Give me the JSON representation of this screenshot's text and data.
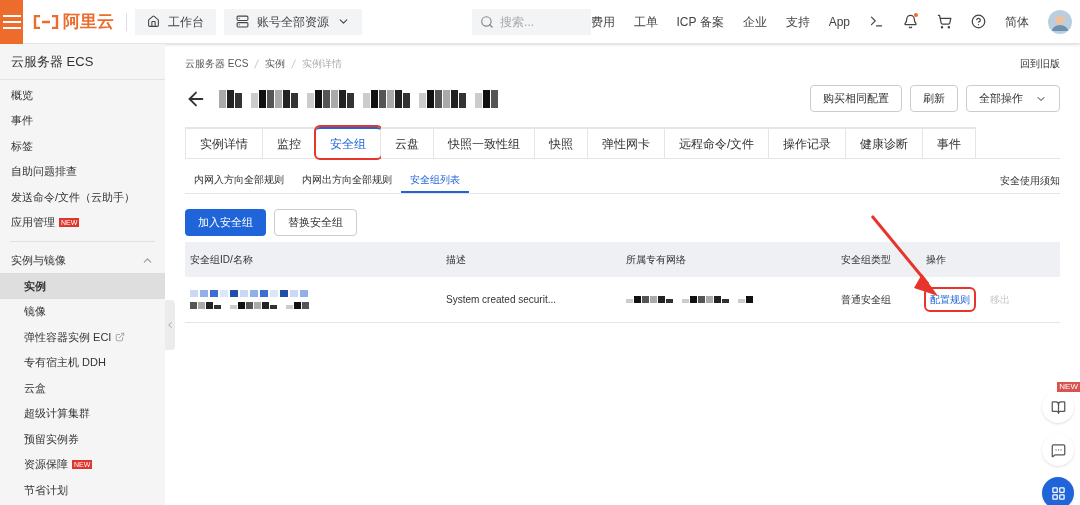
{
  "topbar": {
    "logo_text": "阿里云",
    "workbench": "工作台",
    "resources": "账号全部资源",
    "search_placeholder": "搜索...",
    "links": [
      "费用",
      "工单",
      "ICP 备案",
      "企业",
      "支持",
      "App"
    ],
    "language": "简体"
  },
  "sidebar": {
    "title": "云服务器 ECS",
    "items": [
      {
        "label": "概览",
        "selected": false
      },
      {
        "label": "事件",
        "selected": false
      },
      {
        "label": "标签",
        "selected": false
      },
      {
        "label": "自助问题排查",
        "selected": false
      },
      {
        "label": "发送命令/文件（云助手）",
        "selected": false
      },
      {
        "label": "应用管理",
        "badge": "NEW",
        "selected": false
      }
    ],
    "groups": [
      {
        "label": "实例与镜像",
        "expanded": true,
        "children": [
          {
            "label": "实例",
            "selected": true
          },
          {
            "label": "镜像",
            "selected": false
          },
          {
            "label": "弹性容器实例 ECI",
            "external": true,
            "selected": false
          },
          {
            "label": "专有宿主机 DDH",
            "selected": false
          },
          {
            "label": "云盒",
            "selected": false
          },
          {
            "label": "超级计算集群",
            "selected": false
          },
          {
            "label": "预留实例券",
            "selected": false
          },
          {
            "label": "资源保障",
            "badge": "NEW",
            "selected": false
          },
          {
            "label": "节省计划",
            "selected": false
          }
        ]
      }
    ]
  },
  "breadcrumb": [
    "云服务器 ECS",
    "实例",
    "实例详情"
  ],
  "back_to_old": "回到旧版",
  "header_buttons": [
    {
      "label": "购买相同配置",
      "dropdown": false
    },
    {
      "label": "刷新",
      "dropdown": false
    },
    {
      "label": "全部操作",
      "dropdown": true
    }
  ],
  "tabs": [
    {
      "label": "实例详情",
      "selected": false,
      "highlighted": false
    },
    {
      "label": "监控",
      "selected": false,
      "highlighted": false
    },
    {
      "label": "安全组",
      "selected": true,
      "highlighted": true
    },
    {
      "label": "云盘",
      "selected": false,
      "highlighted": false
    },
    {
      "label": "快照一致性组",
      "selected": false,
      "highlighted": false
    },
    {
      "label": "快照",
      "selected": false,
      "highlighted": false
    },
    {
      "label": "弹性网卡",
      "selected": false,
      "highlighted": false
    },
    {
      "label": "远程命令/文件",
      "selected": false,
      "highlighted": false
    },
    {
      "label": "操作记录",
      "selected": false,
      "highlighted": false
    },
    {
      "label": "健康诊断",
      "selected": false,
      "highlighted": false
    },
    {
      "label": "事件",
      "selected": false,
      "highlighted": false
    }
  ],
  "subtabs": [
    {
      "label": "内网入方向全部规则",
      "selected": false
    },
    {
      "label": "内网出方向全部规则",
      "selected": false
    },
    {
      "label": "安全组列表",
      "selected": true
    }
  ],
  "notice_link": "安全使用须知",
  "actions": [
    {
      "label": "加入安全组",
      "kind": "primary"
    },
    {
      "label": "替换安全组",
      "kind": "default"
    }
  ],
  "table": {
    "columns": [
      "安全组ID/名称",
      "描述",
      "所属专有网络",
      "安全组类型",
      "操作"
    ],
    "rows": [
      {
        "description": "System created securit...",
        "type": "普通安全组",
        "actions": [
          {
            "label": "配置规则",
            "disabled": false,
            "highlighted": true
          },
          {
            "label": "移出",
            "disabled": true,
            "highlighted": false
          }
        ]
      }
    ]
  },
  "float_buttons": [
    {
      "kind": "guide",
      "badge": "NEW"
    },
    {
      "kind": "chat"
    },
    {
      "kind": "apps"
    }
  ]
}
